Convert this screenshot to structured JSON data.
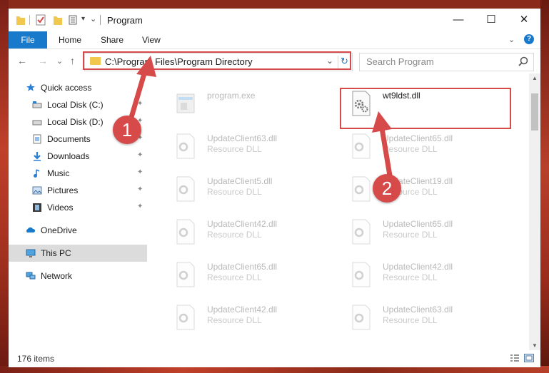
{
  "window": {
    "title": "Program",
    "controls": {
      "minimize": "—",
      "maximize": "☐",
      "close": "✕"
    }
  },
  "ribbon": {
    "file_tab": "File",
    "tabs": [
      "Home",
      "Share",
      "View"
    ],
    "toggle": "⌄",
    "help": "?"
  },
  "address": {
    "path": "C:\\Program Files\\Program Directory",
    "dropdown": "⌄",
    "refresh": "↻"
  },
  "search": {
    "placeholder": "Search Program"
  },
  "navigation": {
    "back": "←",
    "forward": "→",
    "recent": "⌄",
    "up": "↑"
  },
  "nav_pane": {
    "quick_access": "Quick access",
    "pinned": [
      {
        "label": "Local Disk (C:)",
        "icon": "drive-icon"
      },
      {
        "label": "Local Disk (D:)",
        "icon": "drive-icon"
      },
      {
        "label": "Documents",
        "icon": "documents-icon"
      },
      {
        "label": "Downloads",
        "icon": "downloads-icon"
      },
      {
        "label": "Music",
        "icon": "music-icon"
      },
      {
        "label": "Pictures",
        "icon": "pictures-icon"
      },
      {
        "label": "Videos",
        "icon": "videos-icon"
      }
    ],
    "onedrive": "OneDrive",
    "this_pc": "This PC",
    "network": "Network",
    "pin_glyph": "📌"
  },
  "files": [
    {
      "name": "program.exe",
      "type": "",
      "faded": true,
      "icon": "exe-icon"
    },
    {
      "name": "wt9ldst.dll",
      "type": "",
      "faded": false,
      "icon": "dll-icon"
    },
    {
      "name": "UpdateClient63.dll",
      "type": "Resource DLL",
      "faded": true,
      "icon": "dll-icon"
    },
    {
      "name": "UpdateClient65.dll",
      "type": "Resource DLL",
      "faded": true,
      "icon": "dll-icon"
    },
    {
      "name": "UpdateClient5.dll",
      "type": "Resource DLL",
      "faded": true,
      "icon": "dll-icon"
    },
    {
      "name": "UpdateClient19.dll",
      "type": "Resource DLL",
      "faded": true,
      "icon": "dll-icon"
    },
    {
      "name": "UpdateClient42.dll",
      "type": "Resource DLL",
      "faded": true,
      "icon": "dll-icon"
    },
    {
      "name": "UpdateClient65.dll",
      "type": "Resource DLL",
      "faded": true,
      "icon": "dll-icon"
    },
    {
      "name": "UpdateClient65.dll",
      "type": "Resource DLL",
      "faded": true,
      "icon": "dll-icon"
    },
    {
      "name": "UpdateClient42.dll",
      "type": "Resource DLL",
      "faded": true,
      "icon": "dll-icon"
    },
    {
      "name": "UpdateClient42.dll",
      "type": "Resource DLL",
      "faded": true,
      "icon": "dll-icon"
    },
    {
      "name": "UpdateClient63.dll",
      "type": "Resource DLL",
      "faded": true,
      "icon": "dll-icon"
    }
  ],
  "status": {
    "count": "176 items"
  },
  "callouts": {
    "one": "1",
    "two": "2"
  },
  "colors": {
    "accent": "#1979ca",
    "highlight": "#d64a4a",
    "folder": "#f2c74e"
  }
}
